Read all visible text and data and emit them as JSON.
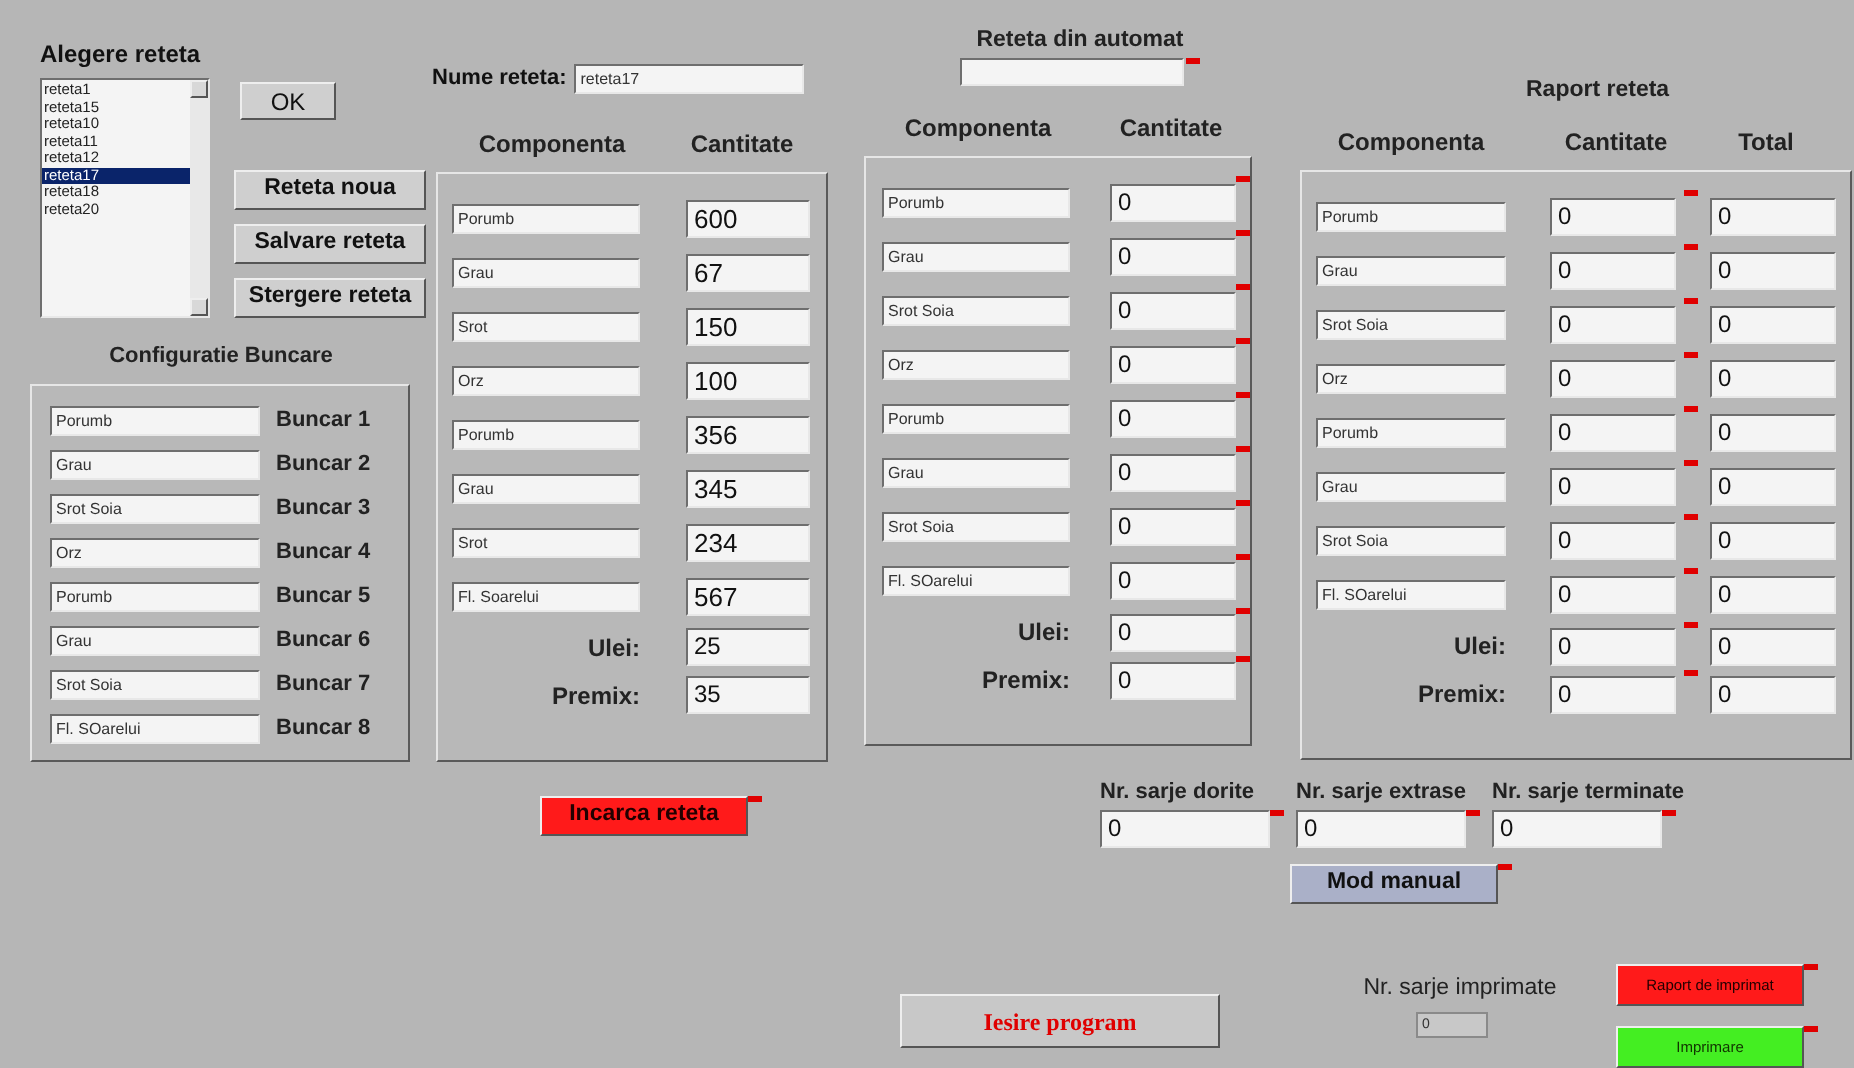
{
  "recipe_select": {
    "title": "Alegere reteta",
    "items": [
      {
        "label": "reteta1",
        "selected": false
      },
      {
        "label": "reteta15",
        "selected": false
      },
      {
        "label": "reteta10",
        "selected": false
      },
      {
        "label": "reteta11",
        "selected": false
      },
      {
        "label": "reteta12",
        "selected": false
      },
      {
        "label": "reteta17",
        "selected": true
      },
      {
        "label": "reteta18",
        "selected": false
      },
      {
        "label": "reteta20",
        "selected": false
      }
    ],
    "ok_button": "OK",
    "buttons": [
      "Reteta noua",
      "Salvare reteta",
      "Stergere reteta"
    ]
  },
  "bunker_config": {
    "title": "Configuratie Buncare",
    "rows": [
      {
        "value": "Porumb",
        "label": "Buncar 1"
      },
      {
        "value": "Grau",
        "label": "Buncar 2"
      },
      {
        "value": "Srot Soia",
        "label": "Buncar 3"
      },
      {
        "value": "Orz",
        "label": "Buncar 4"
      },
      {
        "value": "Porumb",
        "label": "Buncar 5"
      },
      {
        "value": "Grau",
        "label": "Buncar 6"
      },
      {
        "value": "Srot Soia",
        "label": "Buncar 7"
      },
      {
        "value": "Fl. SOarelui",
        "label": "Buncar 8"
      }
    ]
  },
  "recipe": {
    "name_label": "Nume reteta:",
    "name_value": "reteta17",
    "columns": [
      "Componenta",
      "Cantitate"
    ],
    "rows": [
      {
        "component": "Porumb",
        "quantity": "600"
      },
      {
        "component": "Grau",
        "quantity": "67"
      },
      {
        "component": "Srot",
        "quantity": "150"
      },
      {
        "component": "Orz",
        "quantity": "100"
      },
      {
        "component": "Porumb",
        "quantity": "356"
      },
      {
        "component": "Grau",
        "quantity": "345"
      },
      {
        "component": "Srot",
        "quantity": "234"
      },
      {
        "component": "Fl. Soarelui",
        "quantity": "567"
      }
    ],
    "extras": [
      {
        "label": "Ulei:",
        "quantity": "25"
      },
      {
        "label": "Premix:",
        "quantity": "35"
      }
    ],
    "load_button": "Incarca reteta"
  },
  "automat": {
    "title": "Reteta din automat",
    "columns": [
      "Componenta",
      "Cantitate"
    ],
    "rows": [
      {
        "component": "Porumb",
        "quantity": "0"
      },
      {
        "component": "Grau",
        "quantity": "0"
      },
      {
        "component": "Srot Soia",
        "quantity": "0"
      },
      {
        "component": "Orz",
        "quantity": "0"
      },
      {
        "component": "Porumb",
        "quantity": "0"
      },
      {
        "component": "Grau",
        "quantity": "0"
      },
      {
        "component": "Srot Soia",
        "quantity": "0"
      },
      {
        "component": "Fl. SOarelui",
        "quantity": "0"
      }
    ],
    "extras": [
      {
        "label": "Ulei:",
        "quantity": "0"
      },
      {
        "label": "Premix:",
        "quantity": "0"
      }
    ]
  },
  "report": {
    "title": "Raport reteta",
    "columns": [
      "Componenta",
      "Cantitate",
      "Total"
    ],
    "rows": [
      {
        "component": "Porumb",
        "quantity": "0",
        "total": "0"
      },
      {
        "component": "Grau",
        "quantity": "0",
        "total": "0"
      },
      {
        "component": "Srot Soia",
        "quantity": "0",
        "total": "0"
      },
      {
        "component": "Orz",
        "quantity": "0",
        "total": "0"
      },
      {
        "component": "Porumb",
        "quantity": "0",
        "total": "0"
      },
      {
        "component": "Grau",
        "quantity": "0",
        "total": "0"
      },
      {
        "component": "Srot Soia",
        "quantity": "0",
        "total": "0"
      },
      {
        "component": "Fl. SOarelui",
        "quantity": "0",
        "total": "0"
      }
    ],
    "extras": [
      {
        "label": "Ulei:",
        "quantity": "0",
        "total": "0"
      },
      {
        "label": "Premix:",
        "quantity": "0",
        "total": "0"
      }
    ]
  },
  "batches": [
    {
      "label": "Nr. sarje dorite",
      "value": "0"
    },
    {
      "label": "Nr. sarje extrase",
      "value": "0"
    },
    {
      "label": "Nr. sarje terminate",
      "value": "0"
    }
  ],
  "manual_button": "Mod manual",
  "exit_button": "Iesire program",
  "printed": {
    "label": "Nr. sarje imprimate",
    "value": "0"
  },
  "print_report_button": "Raport de imprimat",
  "print_button": "Imprimare"
}
